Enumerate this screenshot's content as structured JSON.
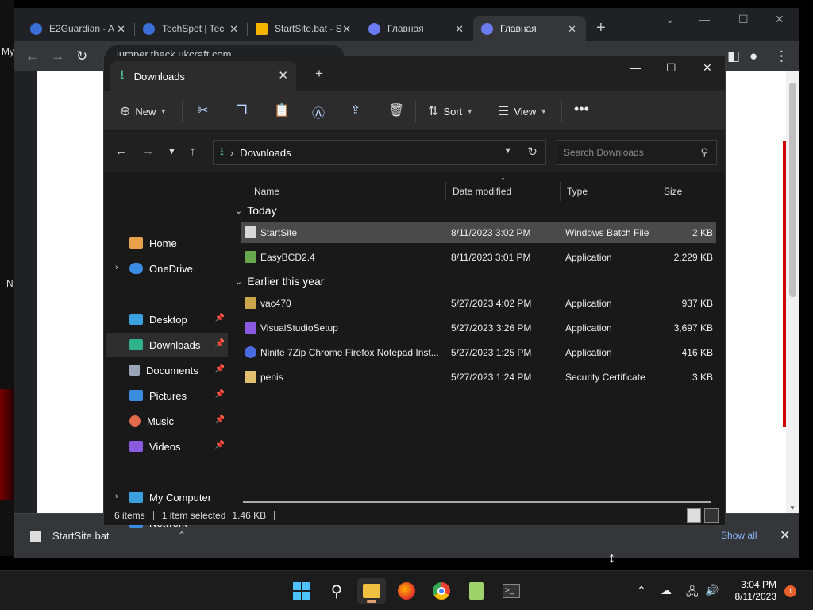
{
  "browser": {
    "tabs": [
      {
        "label": "E2Guardian - A",
        "color": "#3b6fd6"
      },
      {
        "label": "TechSpot | Tec",
        "color": "#3b6fd6"
      },
      {
        "label": "StartSite.bat - S",
        "color": "#f4b400"
      },
      {
        "label": "Главная",
        "color": "#6a7cf0"
      },
      {
        "label": "Главная",
        "color": "#6a7cf0"
      }
    ],
    "url": "jumper.theck.ukcraft.com",
    "left_text": "My",
    "left_text2": "N",
    "download": {
      "filename": "StartSite.bat",
      "show_all": "Show all"
    }
  },
  "explorer": {
    "tab_title": "Downloads",
    "commands": {
      "new": "New",
      "sort": "Sort",
      "view": "View"
    },
    "address": "Downloads",
    "search_placeholder": "Search Downloads",
    "nav_pane": [
      {
        "label": "Home",
        "icon_color": "#e8a04a"
      },
      {
        "label": "OneDrive",
        "icon_color": "#3a8de0"
      },
      {
        "label": "Desktop",
        "icon_color": "#3aa0e0"
      },
      {
        "label": "Downloads",
        "icon_color": "#2fb38c"
      },
      {
        "label": "Documents",
        "icon_color": "#9aa6b8"
      },
      {
        "label": "Pictures",
        "icon_color": "#3a8de0"
      },
      {
        "label": "Music",
        "icon_color": "#e06a4a"
      },
      {
        "label": "Videos",
        "icon_color": "#8a5ae0"
      },
      {
        "label": "My Computer",
        "icon_color": "#3aa0e0"
      },
      {
        "label": "Network",
        "icon_color": "#3a8de0"
      }
    ],
    "columns": {
      "name": "Name",
      "date": "Date modified",
      "type": "Type",
      "size": "Size"
    },
    "groups": {
      "today": "Today",
      "earlier": "Earlier this year"
    },
    "files_today": [
      {
        "name": "StartSite",
        "date": "8/11/2023 3:02 PM",
        "type": "Windows Batch File",
        "size": "2 KB",
        "icon_color": "#d8d8d8"
      },
      {
        "name": "EasyBCD2.4",
        "date": "8/11/2023 3:01 PM",
        "type": "Application",
        "size": "2,229 KB",
        "icon_color": "#6aa84f"
      }
    ],
    "files_earlier": [
      {
        "name": "vac470",
        "date": "5/27/2023 4:02 PM",
        "type": "Application",
        "size": "937 KB",
        "icon_color": "#c8a84a"
      },
      {
        "name": "VisualStudioSetup",
        "date": "5/27/2023 3:26 PM",
        "type": "Application",
        "size": "3,697 KB",
        "icon_color": "#8a5ae0"
      },
      {
        "name": "Ninite 7Zip Chrome Firefox Notepad Inst...",
        "date": "5/27/2023 1:25 PM",
        "type": "Application",
        "size": "416 KB",
        "icon_color": "#4a6ae0"
      },
      {
        "name": "penis",
        "date": "5/27/2023 1:24 PM",
        "type": "Security Certificate",
        "size": "3 KB",
        "icon_color": "#e0c070"
      }
    ],
    "status": {
      "items": "6 items",
      "selected": "1 item selected",
      "size": "1.46 KB"
    }
  },
  "taskbar": {
    "time": "3:04 PM",
    "date": "8/11/2023",
    "notifications": "1"
  }
}
